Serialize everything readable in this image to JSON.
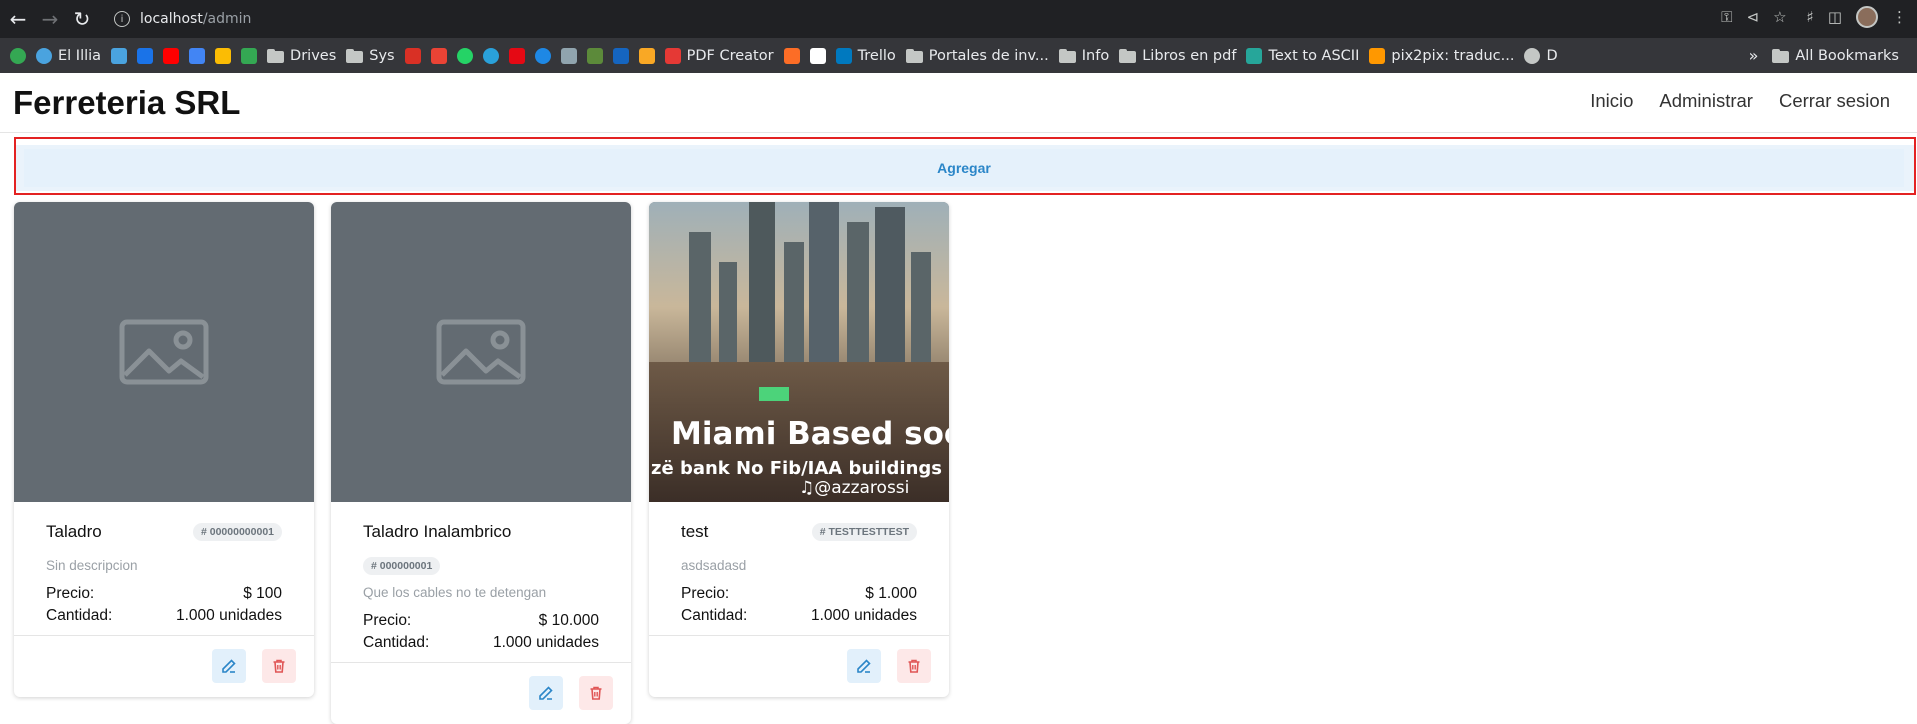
{
  "browser": {
    "url_host": "localhost",
    "url_path": "/admin",
    "bookmarks": [
      {
        "label": "",
        "icon": "green-circle-icon",
        "color": "#34a853"
      },
      {
        "label": "El Illia",
        "icon": "globe-icon",
        "color": "#4aa3df"
      },
      {
        "label": "",
        "icon": "windows-icon",
        "color": "#4aa3df"
      },
      {
        "label": "",
        "icon": "outlook-icon",
        "color": "#1a73e8"
      },
      {
        "label": "",
        "icon": "youtube-icon",
        "color": "#ff0000"
      },
      {
        "label": "",
        "icon": "translate-icon",
        "color": "#4285f4"
      },
      {
        "label": "",
        "icon": "photos-icon",
        "color": "#fbbc04"
      },
      {
        "label": "",
        "icon": "drive-icon",
        "color": "#34a853"
      },
      {
        "label": "Drives",
        "icon": "folder-icon",
        "color": "#c4c7c5"
      },
      {
        "label": "Sys",
        "icon": "folder-icon",
        "color": "#c4c7c5"
      },
      {
        "label": "",
        "icon": "star-icon",
        "color": "#d93025"
      },
      {
        "label": "",
        "icon": "gmail-icon",
        "color": "#ea4335"
      },
      {
        "label": "",
        "icon": "whatsapp-icon",
        "color": "#25d366"
      },
      {
        "label": "",
        "icon": "telegram-icon",
        "color": "#2aa1da"
      },
      {
        "label": "",
        "icon": "netflix-icon",
        "color": "#e50914"
      },
      {
        "label": "",
        "icon": "play-icon",
        "color": "#1e88e5"
      },
      {
        "label": "",
        "icon": "shield-icon",
        "color": "#90a4ae"
      },
      {
        "label": "",
        "icon": "notes-icon",
        "color": "#5c8a3a"
      },
      {
        "label": "",
        "icon": "cup-icon",
        "color": "#1565c0"
      },
      {
        "label": "",
        "icon": "image-icon",
        "color": "#f9a825"
      },
      {
        "label": "PDF Creator",
        "icon": "pdf-icon",
        "color": "#e53935"
      },
      {
        "label": "",
        "icon": "gitlab-icon",
        "color": "#fc6d26"
      },
      {
        "label": "",
        "icon": "x-icon",
        "color": "#ffffff"
      },
      {
        "label": "Trello",
        "icon": "trello-icon",
        "color": "#0079bf"
      },
      {
        "label": "Portales de inv...",
        "icon": "folder-icon",
        "color": "#c4c7c5"
      },
      {
        "label": "Info",
        "icon": "folder-icon",
        "color": "#c4c7c5"
      },
      {
        "label": "Libros en pdf",
        "icon": "folder-icon",
        "color": "#c4c7c5"
      },
      {
        "label": "Text to ASCII",
        "icon": "ascii-icon",
        "color": "#26a69a"
      },
      {
        "label": "pix2pix: traduc...",
        "icon": "pix2pix-icon",
        "color": "#ff9800"
      },
      {
        "label": "D",
        "icon": "globe-icon",
        "color": "#c4c7c5"
      }
    ],
    "all_bookmarks": "All Bookmarks"
  },
  "header": {
    "brand": "Ferreteria SRL",
    "nav": [
      "Inicio",
      "Administrar",
      "Cerrar sesion"
    ]
  },
  "add_button": "Agregar",
  "products": [
    {
      "title": "Taladro",
      "code": "# 00000000001",
      "description": "Sin descripcion",
      "price_label": "Precio:",
      "price": "$ 100",
      "qty_label": "Cantidad:",
      "qty": "1.000 unidades",
      "image": "placeholder"
    },
    {
      "title": "Taladro Inalambrico",
      "code": "# 000000001",
      "description": "Que los cables no te detengan",
      "price_label": "Precio:",
      "price": "$ 10.000",
      "qty_label": "Cantidad:",
      "qty": "1.000 unidades",
      "image": "placeholder"
    },
    {
      "title": "test",
      "code": "# TESTTESTTEST",
      "description": "asdsadasd",
      "price_label": "Precio:",
      "price": "$ 1.000",
      "qty_label": "Cantidad:",
      "qty": "1.000 unidades",
      "image": "photo",
      "photo_text": [
        "Miami Based soo.",
        "zë bank No Fib/IAA  buildings",
        "@azzarossi"
      ]
    }
  ],
  "colors": {
    "accent": "#2b86c8",
    "danger": "#e05656",
    "highlight": "#e32222"
  }
}
